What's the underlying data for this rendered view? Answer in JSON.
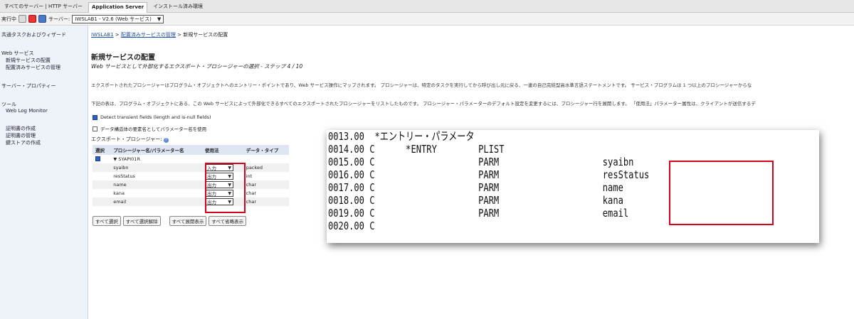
{
  "topbar": {
    "tabs": [
      {
        "label": "すべてのサーバー | HTTP サーバー",
        "active": false
      },
      {
        "label": "Application Server",
        "active": true
      },
      {
        "label": "インストール済み環境",
        "active": false
      }
    ]
  },
  "toolbar": {
    "status": "実行中",
    "server_label": "サーバー:",
    "server_value": "IWSLAB1 - V2.6 (Web サービス)"
  },
  "leftnav": {
    "items": [
      "共通タスクおよびウィザード",
      "Web サービス",
      "新規サービスの配置",
      "配置済みサービスの管理",
      "サーバー・プロパティー",
      "ツール",
      "Web Log Monitor",
      "証明書の作成",
      "証明書の管理",
      "鍵ストアの作成"
    ]
  },
  "breadcrumb": {
    "link1": "IWSLAB1",
    "sep": " > ",
    "link2": "配置済みサービスの管理",
    "current": "新規サービスの配置"
  },
  "page": {
    "title": "新規サービスの配置",
    "subtitle": "Web サービスとして外部化するエクスポート・プロシージャーの選択 - ステップ 4 / 10",
    "para1": "エクスポートされたプロシージャーはプログラム・オブジェクトへのエントリー・ポイントであり、Web サービス操作にマップされます。 プロシージャーは、特定のタスクを実行してから呼び出し元に戻る、一連の自己完結型高水準言語ステートメントです。 サービス・プログラムは 1 つ以上のプロシージャーからな",
    "para2": "下記の表は、プログラム・オブジェクトにある、この Web サービスによって外部化できるすべてのエクスポートされたプロシージャーをリストしたものです。 プロシージャー・パラメーターのデフォルト設定を変更するには、プロシージャー行を展開します。 「使用法」パラメーター属性は、クライアントが送信するデ",
    "opt1": "Detect transient fields (length and is-null fields)",
    "opt2": "データ構造体の要素名としてパラメーター名を使用",
    "export_label": "エクスポート・プロシージャー:",
    "help": "?"
  },
  "table": {
    "headers": [
      "選択",
      "プロシージャー名/パラメーター名",
      "使用法",
      "データ・タイプ"
    ],
    "procedure": "SYAPI01R",
    "rows": [
      {
        "name": "syaibn",
        "usage": "入力",
        "type": "packed"
      },
      {
        "name": "resStatus",
        "usage": "出力",
        "type": "int"
      },
      {
        "name": "name",
        "usage": "出力",
        "type": "char"
      },
      {
        "name": "kana",
        "usage": "出力",
        "type": "char"
      },
      {
        "name": "email",
        "usage": "出力",
        "type": "char"
      }
    ]
  },
  "buttons": {
    "select_all": "すべて選択",
    "deselect_all": "すべて選択解除",
    "expand_all": "すべて展開表示",
    "collapse_all": "すべて省略表示"
  },
  "code": {
    "lines": [
      "0013.00  *エントリー・パラメータ",
      "0014.00 C      *ENTRY        PLIST",
      "0015.00 C                    PARM                    syaibn",
      "0016.00 C                    PARM                    resStatus",
      "0017.00 C                    PARM                    name",
      "0018.00 C                    PARM                    kana",
      "0019.00 C                    PARM                    email",
      "0020.00 C"
    ]
  },
  "colors": {
    "highlight_box": "#d9001b",
    "link": "#1a4fa0",
    "nav_bg": "#eef3fa"
  }
}
